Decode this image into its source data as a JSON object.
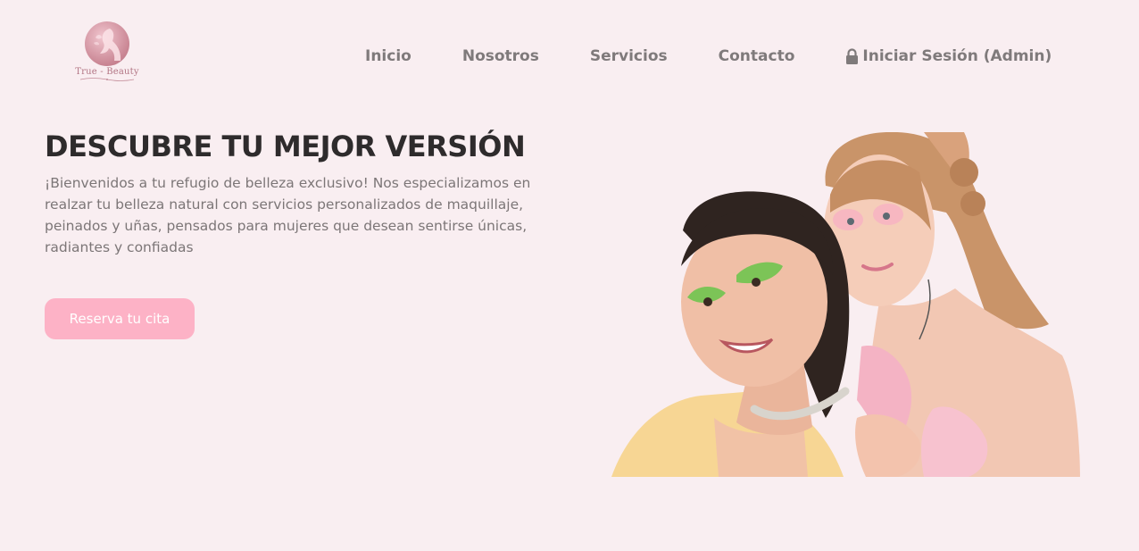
{
  "brand": {
    "name": "True - Beauty",
    "logo_icon": "woman-silhouette-logo-icon"
  },
  "nav": {
    "items": [
      {
        "label": "Inicio"
      },
      {
        "label": "Nosotros"
      },
      {
        "label": "Servicios"
      },
      {
        "label": "Contacto"
      }
    ],
    "admin": {
      "label": "Iniciar Sesión (Admin)",
      "icon": "lock-icon"
    }
  },
  "hero": {
    "title": "DESCUBRE TU MEJOR VERSIÓN",
    "text": "¡Bienvenidos a tu refugio de belleza exclusivo! Nos especializamos en realzar tu belleza natural con servicios personalizados de maquillaje, peinados y uñas, pensados para mujeres que desean sentirse únicas, radiantes y confiadas",
    "cta": "Reserva tu cita",
    "image": "hero-photo-two-women-makeup"
  },
  "colors": {
    "background": "#f9eef1",
    "cta": "#fdb2c6",
    "nav_text": "#7f7a7b",
    "title": "#2e2b2c"
  }
}
